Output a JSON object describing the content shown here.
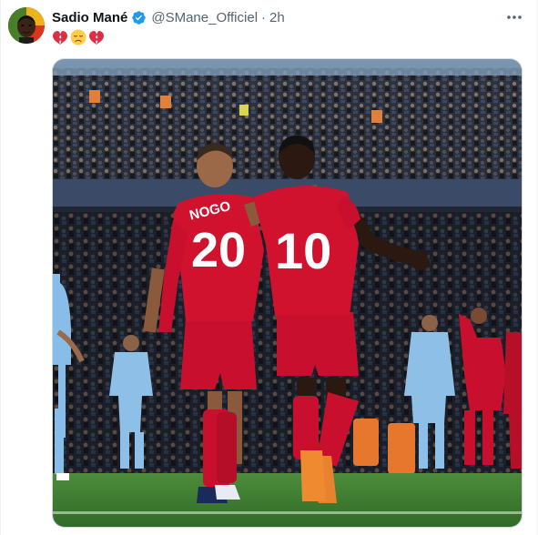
{
  "tweet": {
    "author_name": "Sadio Mané",
    "handle": "@SMane_Officiel",
    "separator": "·",
    "time": "2h",
    "text_emojis": [
      "broken-heart",
      "disappointed-face",
      "broken-heart"
    ],
    "media": {
      "left_jersey_name": "NOGO",
      "left_jersey_number": "20",
      "right_jersey_number": "10"
    }
  },
  "colors": {
    "verified": "#1d9bf0",
    "liverpool_red": "#c8102e",
    "city_blue": "#87bde8",
    "pitch_green": "#3f7f33"
  },
  "icons": {
    "verified": "verified-badge-icon",
    "more": "more-horizontal-icon"
  }
}
